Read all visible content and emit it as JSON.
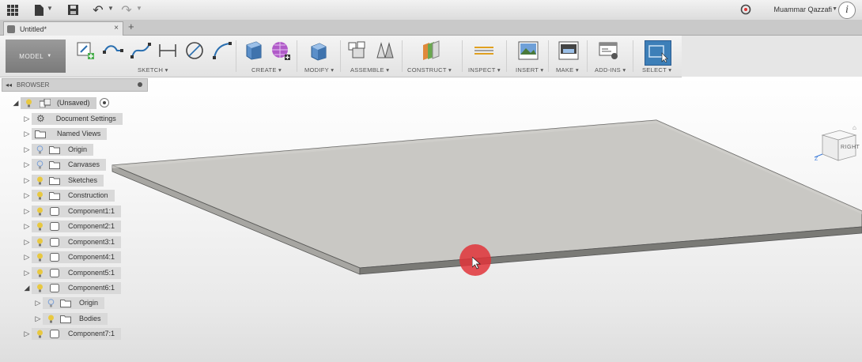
{
  "topbar": {
    "user_name": "Muammar Qazzafi",
    "info_label": "i"
  },
  "tab": {
    "title": "Untitled*",
    "close_label": "×",
    "new_tab_label": "+"
  },
  "ribbon": {
    "workspace_label": "MODEL",
    "groups": {
      "sketch": "SKETCH",
      "create": "CREATE",
      "modify": "MODIFY",
      "assemble": "ASSEMBLE",
      "construct": "CONSTRUCT",
      "inspect": "INSPECT",
      "insert": "INSERT",
      "make": "MAKE",
      "addins": "ADD-INS",
      "select": "SELECT"
    }
  },
  "browser": {
    "title": "BROWSER",
    "root": "(Unsaved)",
    "items": [
      {
        "label": "Document Settings"
      },
      {
        "label": "Named Views"
      },
      {
        "label": "Origin"
      },
      {
        "label": "Canvases"
      },
      {
        "label": "Sketches"
      },
      {
        "label": "Construction"
      },
      {
        "label": "Component1:1"
      },
      {
        "label": "Component2:1"
      },
      {
        "label": "Component3:1"
      },
      {
        "label": "Component4:1"
      },
      {
        "label": "Component5:1"
      },
      {
        "label": "Component6:1"
      },
      {
        "label": "Origin"
      },
      {
        "label": "Bodies"
      },
      {
        "label": "Component7:1"
      }
    ]
  },
  "viewcube": {
    "face_label": "RIGHT",
    "axis_z": "Z"
  },
  "colors": {
    "accent": "#3d7fb8",
    "bulb": "#e8c840",
    "plate_top": "#c9c8c4",
    "plate_edge": "#7a7a76",
    "cursor_highlight": "#e0343a"
  }
}
